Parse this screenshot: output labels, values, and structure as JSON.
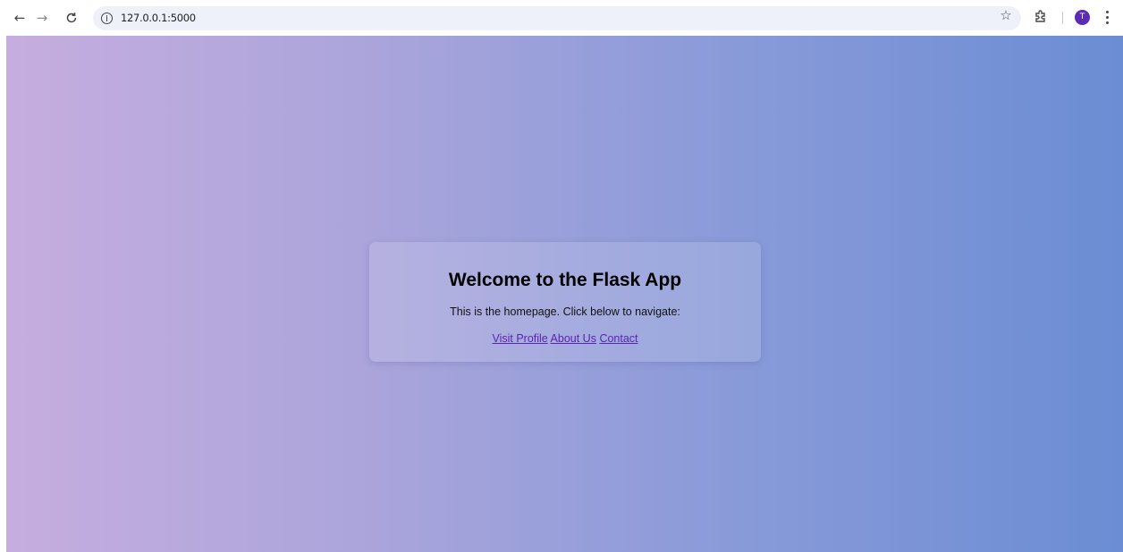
{
  "browser": {
    "url": "127.0.0.1:5000",
    "avatar_initial": "T",
    "icons": [
      "back-arrow-icon",
      "forward-arrow-icon",
      "reload-icon",
      "info-icon",
      "star-icon",
      "extensions-icon",
      "kebab-menu-icon"
    ]
  },
  "page": {
    "title": "Welcome to the Flask App",
    "description": "This is the homepage. Click below to navigate:",
    "links": [
      {
        "label": "Visit Profile"
      },
      {
        "label": "About Us"
      },
      {
        "label": "Contact"
      }
    ]
  },
  "colors": {
    "gradient_start": "#c6addf",
    "gradient_end": "#6b8dd4",
    "link": "#5a24b0",
    "avatar": "#5b2bb5"
  }
}
